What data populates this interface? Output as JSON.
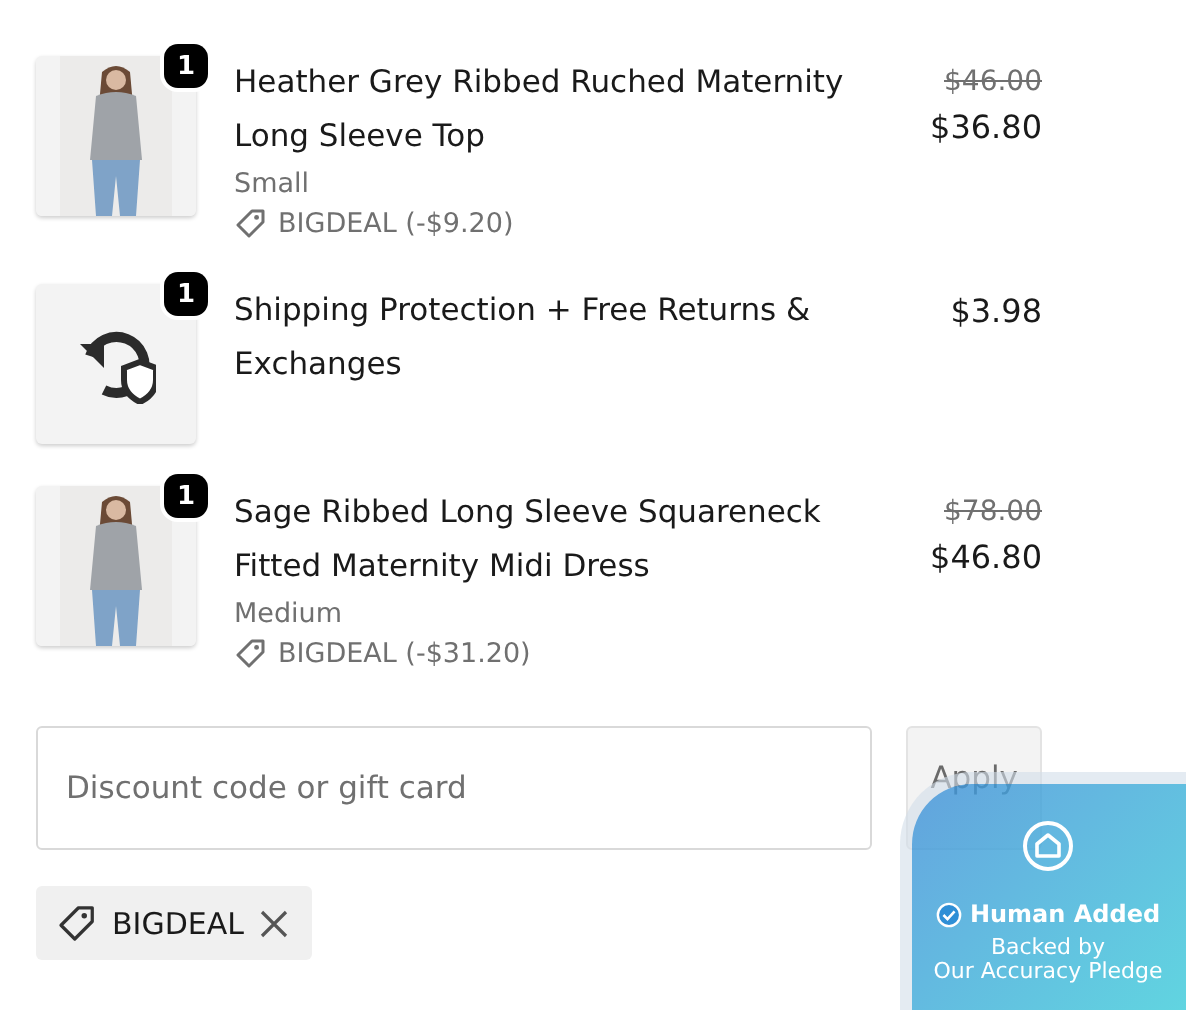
{
  "items": [
    {
      "quantity": "1",
      "title": "Heather Grey Ribbed Ruched Maternity Long Sleeve Top",
      "variant": "Small",
      "discount": "BIGDEAL (-$9.20)",
      "original_price": "$46.00",
      "price": "$36.80"
    },
    {
      "kind": "protection",
      "quantity": "1",
      "title": "Shipping Protection + Free Returns & Exchanges",
      "price": "$3.98"
    },
    {
      "quantity": "1",
      "title": "Sage Ribbed Long Sleeve Squareneck Fitted Maternity Midi Dress",
      "variant": "Medium",
      "discount": "BIGDEAL (-$31.20)",
      "original_price": "$78.00",
      "price": "$46.80"
    }
  ],
  "discount_field": {
    "placeholder": "Discount code or gift card"
  },
  "apply_button": "Apply",
  "applied_codes": [
    "BIGDEAL"
  ],
  "overlay_badge": {
    "title": "Human Added",
    "subtitle": "Backed by\nOur Accuracy Pledge"
  }
}
